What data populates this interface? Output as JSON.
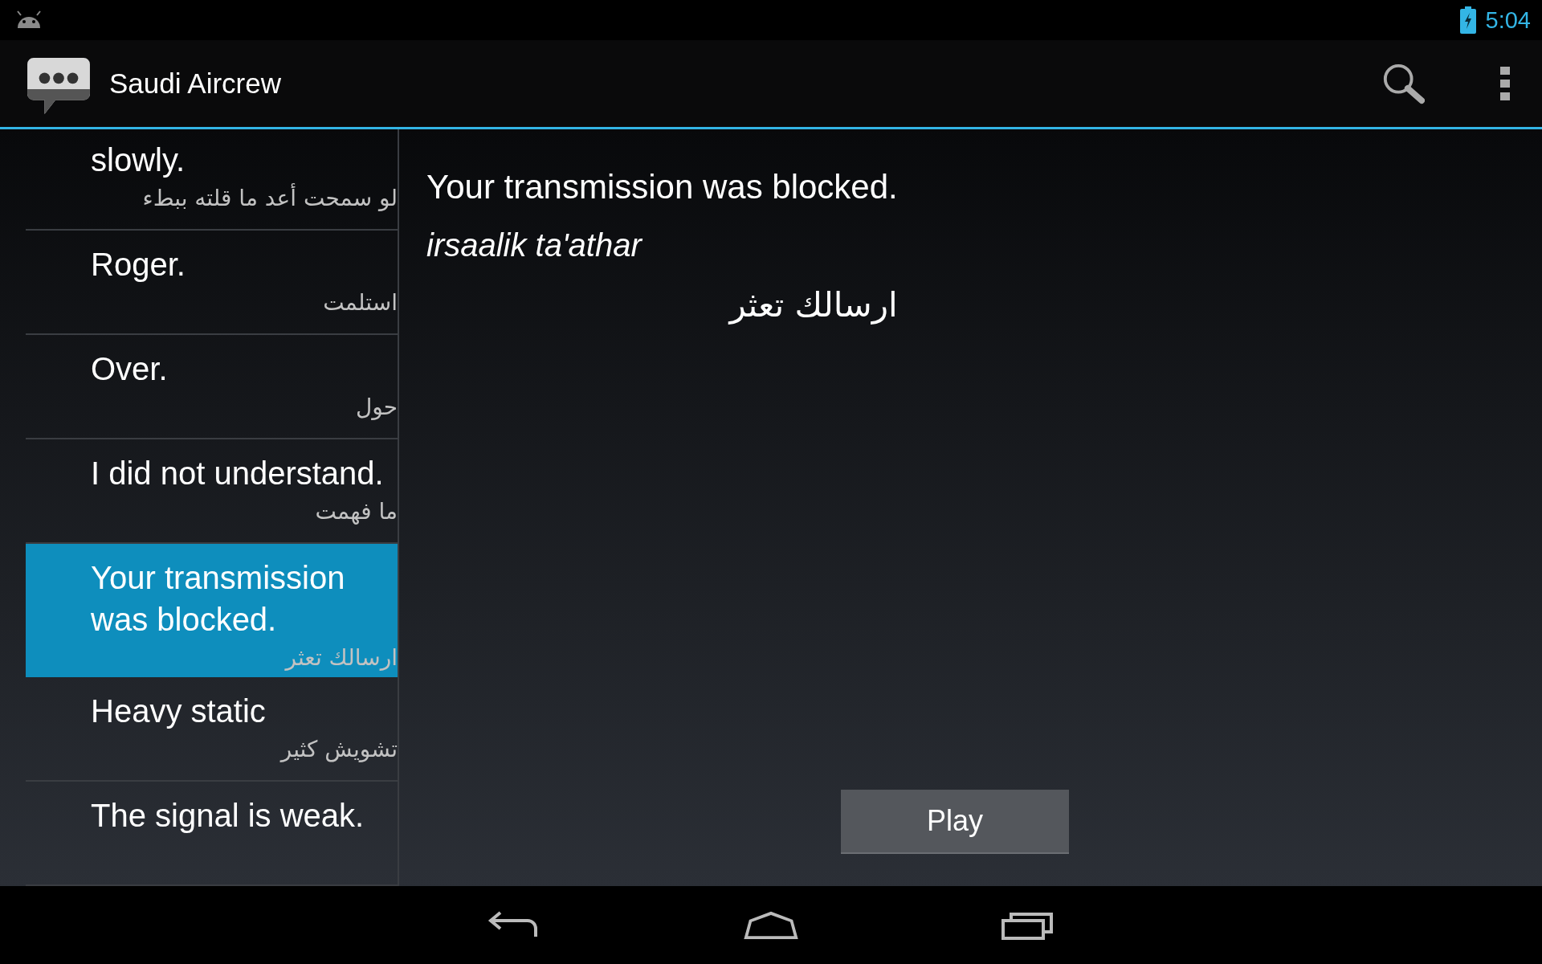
{
  "status_bar": {
    "time": "5:04"
  },
  "action_bar": {
    "title": "Saudi Aircrew"
  },
  "phrases": [
    {
      "english": "slowly.",
      "arabic": "لو سمحت أعد ما قلته ببطء",
      "selected": false
    },
    {
      "english": "Roger.",
      "arabic": "استلمت",
      "selected": false
    },
    {
      "english": "Over.",
      "arabic": "حول",
      "selected": false
    },
    {
      "english": "I did not understand.",
      "arabic": "ما فهمت",
      "selected": false
    },
    {
      "english": "Your transmission was blocked.",
      "arabic": "ارسالك تعثر",
      "selected": true
    },
    {
      "english": "Heavy static",
      "arabic": "تشويش كثير",
      "selected": false
    },
    {
      "english": "The signal is weak.",
      "selected": false
    }
  ],
  "detail": {
    "english": "Your transmission was blocked.",
    "transliteration": "irsaalik ta'athar",
    "arabic": "ارسالك تعثر",
    "play_button": "Play"
  }
}
